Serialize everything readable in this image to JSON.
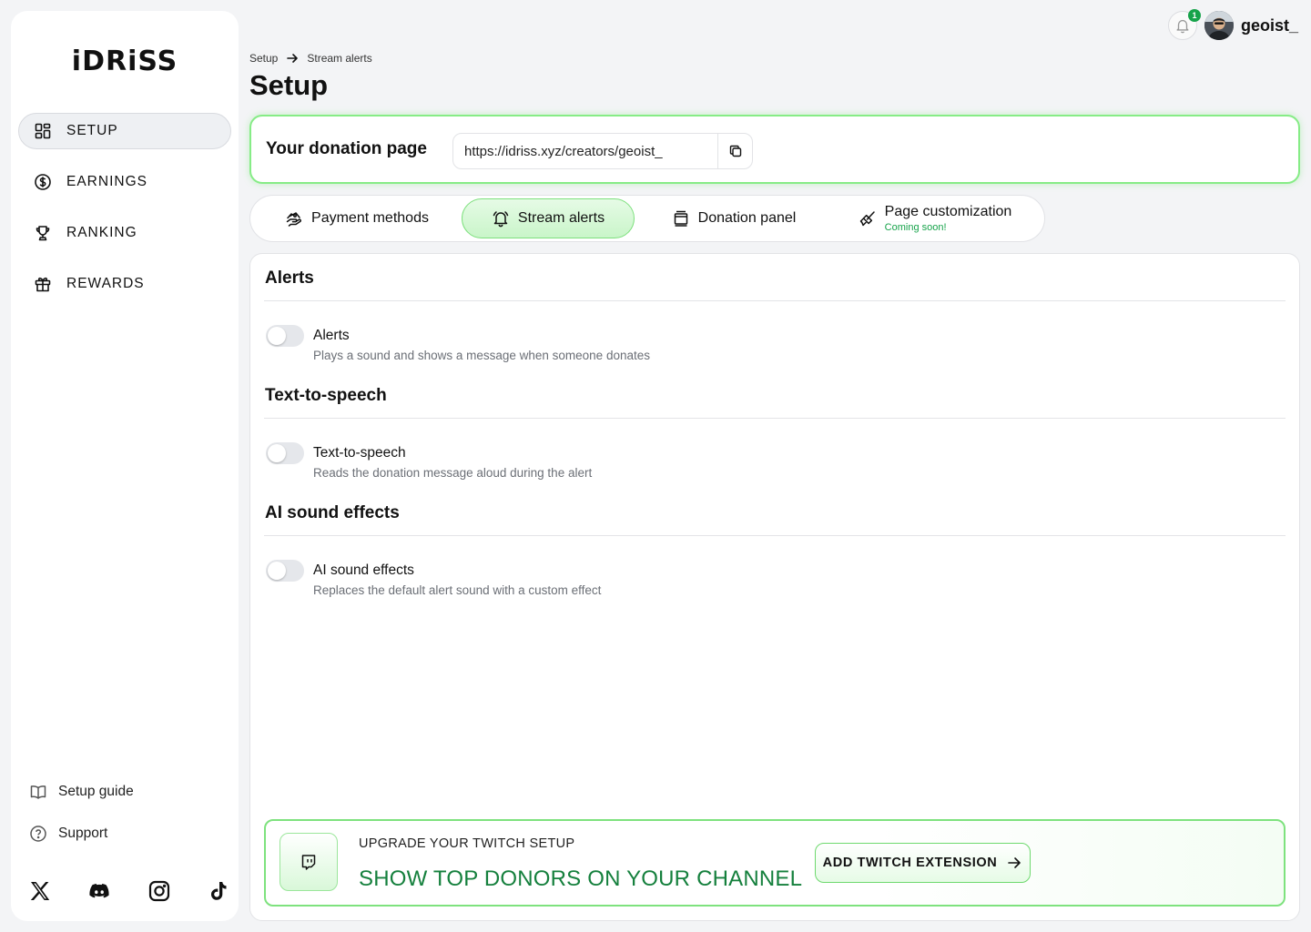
{
  "brand": {
    "logo_text": "iDRiSS"
  },
  "sidebar": {
    "items": [
      {
        "label": "SETUP",
        "icon": "grid-icon",
        "active": true
      },
      {
        "label": "EARNINGS",
        "icon": "dollar-circle-icon",
        "active": false
      },
      {
        "label": "RANKING",
        "icon": "trophy-icon",
        "active": false
      },
      {
        "label": "REWARDS",
        "icon": "gift-icon",
        "active": false
      }
    ],
    "bottom_links": [
      {
        "label": "Setup guide",
        "icon": "book-icon"
      },
      {
        "label": "Support",
        "icon": "help-circle-icon"
      }
    ],
    "socials": [
      "x-icon",
      "discord-icon",
      "instagram-icon",
      "tiktok-icon"
    ]
  },
  "topbar": {
    "notification_count": "1",
    "username": "geoist_"
  },
  "breadcrumb": {
    "first": "Setup",
    "second": "Stream alerts"
  },
  "page_title": "Setup",
  "donation": {
    "label": "Your donation page",
    "url": "https://idriss.xyz/creators/geoist_"
  },
  "tabs": [
    {
      "label": "Payment methods",
      "icon": "payment-icon",
      "active": false
    },
    {
      "label": "Stream alerts",
      "icon": "bell-icon",
      "active": true
    },
    {
      "label": "Donation panel",
      "icon": "panel-icon",
      "active": false
    },
    {
      "label": "Page customization",
      "sublabel": "Coming soon!",
      "icon": "brush-icon",
      "active": false
    }
  ],
  "sections": [
    {
      "title": "Alerts",
      "setting_label": "Alerts",
      "setting_desc": "Plays a sound and shows a message when someone donates",
      "enabled": false
    },
    {
      "title": "Text-to-speech",
      "setting_label": "Text-to-speech",
      "setting_desc": "Reads the donation message aloud during the alert",
      "enabled": false
    },
    {
      "title": "AI sound effects",
      "setting_label": "AI sound effects",
      "setting_desc": "Replaces the default alert sound with a custom effect",
      "enabled": false
    }
  ],
  "twitch_banner": {
    "kicker": "UPGRADE YOUR TWITCH SETUP",
    "headline": "SHOW TOP DONORS ON YOUR CHANNEL",
    "button_label": "ADD TWITCH EXTENSION"
  },
  "colors": {
    "accent_green": "#16a34a",
    "accent_border": "#86ec86",
    "background": "#f3f4f6"
  }
}
